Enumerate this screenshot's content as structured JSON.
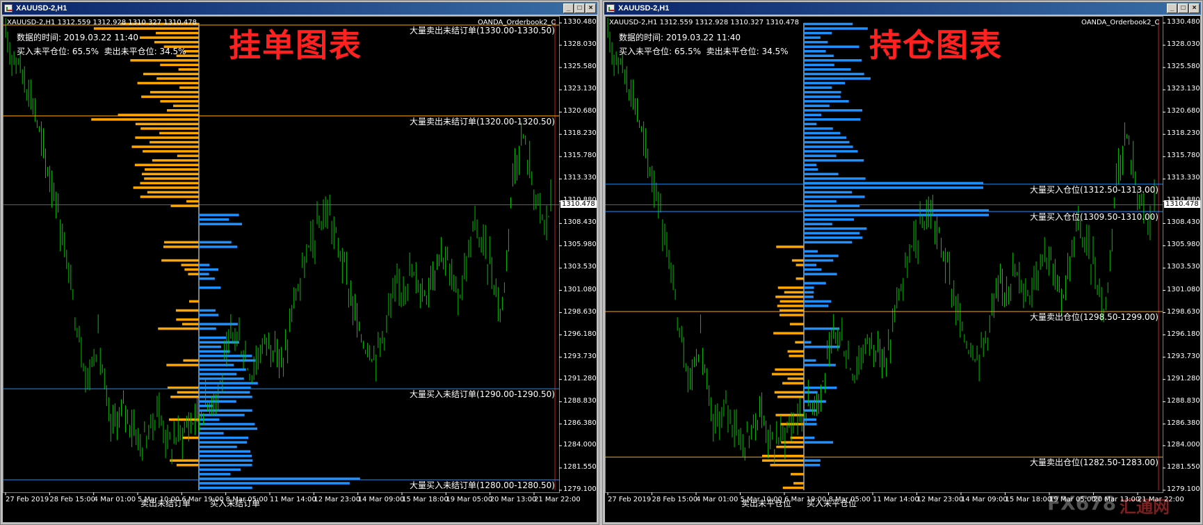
{
  "colors": {
    "up": "#ffa500",
    "down": "#1e90ff",
    "candle": "#00c000",
    "title_red": "#ff2020"
  },
  "price_axis": [
    "1330.480",
    "1328.030",
    "1325.580",
    "1323.130",
    "1320.680",
    "1318.230",
    "1315.780",
    "1313.330",
    "1310.880",
    "1308.430",
    "1305.980",
    "1303.530",
    "1301.080",
    "1298.630",
    "1296.180",
    "1293.730",
    "1291.280",
    "1288.830",
    "1286.380",
    "1284.000",
    "1281.550",
    "1279.100"
  ],
  "current_price": "1310.478",
  "time_axis": [
    "27 Feb 2019",
    "28 Feb 15:00",
    "4 Mar 01:00",
    "5 Mar 10:00",
    "6 Mar 19:00",
    "8 Mar 05:00",
    "11 Mar 14:00",
    "12 Mar 23:00",
    "14 Mar 09:00",
    "15 Mar 18:00",
    "19 Mar 05:00",
    "20 Mar 13:00",
    "21 Mar 22:00"
  ],
  "windows": [
    {
      "title": "XAUUSD-2,H1",
      "symbol_line": "XAUUSD-2,H1  1312.559 1312.928 1310.327 1310.478",
      "indicator": "OANDA_Orderbook2_C",
      "info_time": "数据的时间: 2019.03.22 11:40",
      "info_ratio": "买入未平仓位: 65.5%  卖出未平仓位: 34.5%",
      "big_title": "挂单图表",
      "levels": [
        {
          "label": "大量卖出未结订单(1330.00-1330.50)",
          "price": 1330.25,
          "color": "#ffa500"
        },
        {
          "label": "大量卖出未结订单(1320.00-1320.50)",
          "price": 1320.25,
          "color": "#ffa500"
        },
        {
          "label": "大量买入未结订单(1290.00-1290.50)",
          "price": 1290.25,
          "color": "#1e90ff"
        },
        {
          "label": "大量买入未结订单(1280.00-1280.50)",
          "price": 1280.25,
          "color": "#1e90ff"
        }
      ],
      "bottom_left": "卖出未结订单",
      "bottom_right": "买入未结订单",
      "buttons": {
        "min": "_",
        "max": "□",
        "close": "×"
      }
    },
    {
      "title": "XAUUSD-2,H1",
      "symbol_line": "XAUUSD-2,H1  1312.559 1312.928 1310.327 1310.478",
      "indicator": "OANDA_Orderbook2_C",
      "info_time": "数据的时间: 2019.03.22 11:40",
      "info_ratio": "买入未平仓位: 65.5%  卖出未平仓位: 34.5%",
      "big_title": "持仓图表",
      "levels": [
        {
          "label": "大量买入仓位(1312.50-1313.00)",
          "price": 1312.75,
          "color": "#1e90ff"
        },
        {
          "label": "大量买入仓位(1309.50-1310.00)",
          "price": 1309.75,
          "color": "#1e90ff"
        },
        {
          "label": "大量卖出仓位(1298.50-1299.00)",
          "price": 1298.75,
          "color": "#ffa500"
        },
        {
          "label": "大量卖出仓位(1282.50-1283.00)",
          "price": 1282.75,
          "color": "#ffa500"
        }
      ],
      "bottom_left": "卖出未平仓位",
      "bottom_right": "买入未平仓位",
      "buttons": {
        "min": "_",
        "max": "□",
        "close": "×"
      }
    }
  ],
  "watermark": {
    "brand": "FX678",
    "cn": "汇通网"
  }
}
